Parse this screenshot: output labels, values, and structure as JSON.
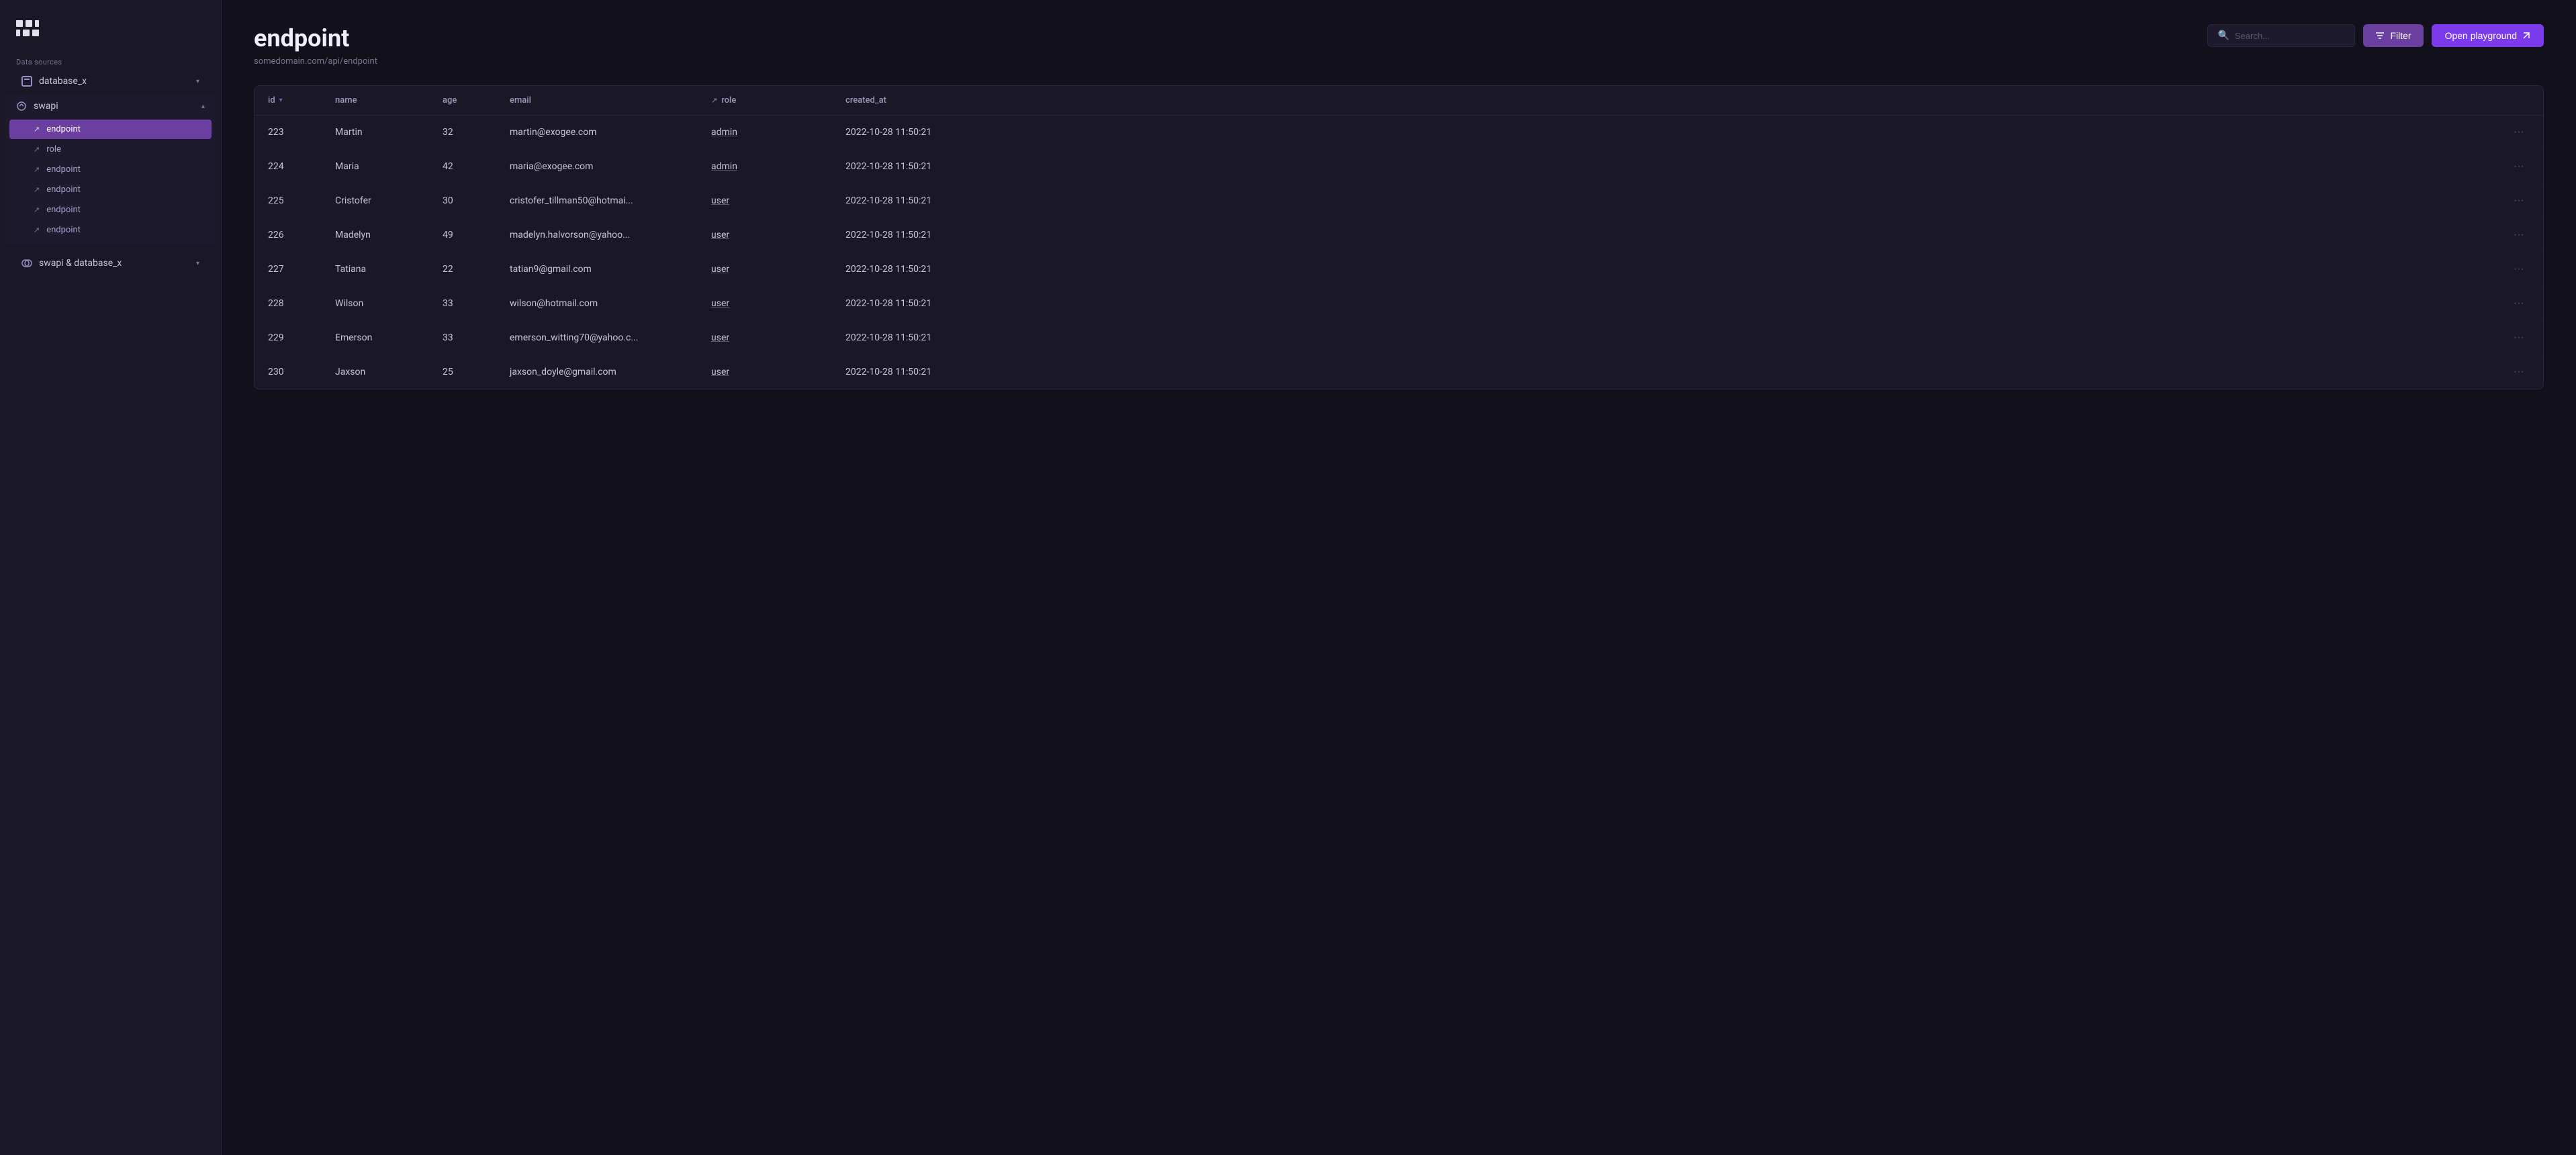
{
  "app": {
    "logo_label": "App Logo"
  },
  "sidebar": {
    "data_sources_label": "Data sources",
    "database_x": {
      "label": "database_x",
      "collapsed": true
    },
    "swapi": {
      "label": "swapi",
      "expanded": true,
      "items": [
        {
          "label": "endpoint",
          "active": true,
          "icon": "arrow-up-right"
        },
        {
          "label": "role",
          "active": false,
          "icon": "arrow-up-right"
        },
        {
          "label": "endpoint",
          "active": false,
          "icon": "arrow-up-right"
        },
        {
          "label": "endpoint",
          "active": false,
          "icon": "arrow-up-right"
        },
        {
          "label": "endpoint",
          "active": false,
          "icon": "arrow-up-right"
        },
        {
          "label": "endpoint",
          "active": false,
          "icon": "arrow-up-right"
        }
      ]
    },
    "swapi_database_x": {
      "label": "swapi & database_x",
      "collapsed": true
    }
  },
  "main": {
    "title": "endpoint",
    "subtitle": "somedomain.com/api/endpoint",
    "search_placeholder": "Search...",
    "filter_label": "Filter",
    "playground_label": "Open playground",
    "table": {
      "columns": [
        {
          "key": "id",
          "label": "id",
          "sortable": true,
          "has_link_arrow": false
        },
        {
          "key": "name",
          "label": "name",
          "sortable": false,
          "has_link_arrow": false
        },
        {
          "key": "age",
          "label": "age",
          "sortable": false,
          "has_link_arrow": false
        },
        {
          "key": "email",
          "label": "email",
          "sortable": false,
          "has_link_arrow": false
        },
        {
          "key": "role",
          "label": "role",
          "sortable": false,
          "has_link_arrow": true
        },
        {
          "key": "created_at",
          "label": "created_at",
          "sortable": false,
          "has_link_arrow": false
        }
      ],
      "rows": [
        {
          "id": "223",
          "name": "Martin",
          "age": "32",
          "email": "martin@exogee.com",
          "role": "admin",
          "created_at": "2022-10-28 11:50:21"
        },
        {
          "id": "224",
          "name": "Maria",
          "age": "42",
          "email": "maria@exogee.com",
          "role": "admin",
          "created_at": "2022-10-28 11:50:21"
        },
        {
          "id": "225",
          "name": "Cristofer",
          "age": "30",
          "email": "cristofer_tillman50@hotmai...",
          "role": "user",
          "created_at": "2022-10-28 11:50:21"
        },
        {
          "id": "226",
          "name": "Madelyn",
          "age": "49",
          "email": "madelyn.halvorson@yahoo...",
          "role": "user",
          "created_at": "2022-10-28 11:50:21"
        },
        {
          "id": "227",
          "name": "Tatiana",
          "age": "22",
          "email": "tatian9@gmail.com",
          "role": "user",
          "created_at": "2022-10-28 11:50:21"
        },
        {
          "id": "228",
          "name": "Wilson",
          "age": "33",
          "email": "wilson@hotmail.com",
          "role": "user",
          "created_at": "2022-10-28 11:50:21"
        },
        {
          "id": "229",
          "name": "Emerson",
          "age": "33",
          "email": "emerson_witting70@yahoo.c...",
          "role": "user",
          "created_at": "2022-10-28 11:50:21"
        },
        {
          "id": "230",
          "name": "Jaxson",
          "age": "25",
          "email": "jaxson_doyle@gmail.com",
          "role": "user",
          "created_at": "2022-10-28 11:50:21"
        }
      ]
    }
  }
}
